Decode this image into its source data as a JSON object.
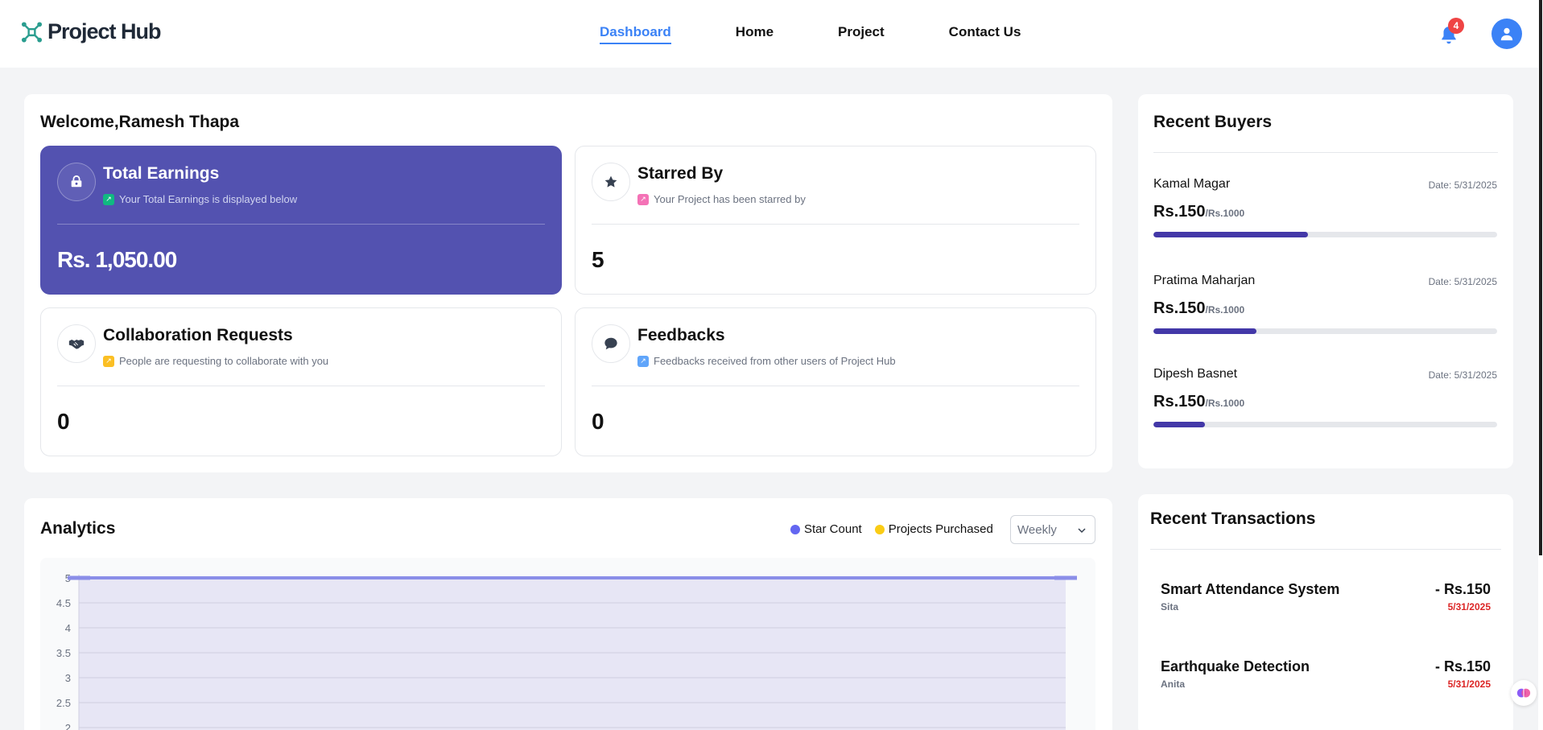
{
  "app": {
    "name": "Project Hub",
    "notification_count": "4"
  },
  "nav": {
    "items": [
      "Dashboard",
      "Home",
      "Project",
      "Contact Us"
    ],
    "active": "Dashboard"
  },
  "welcome": {
    "title": "Welcome,Ramesh Thapa"
  },
  "cards": [
    {
      "title": "Total Earnings",
      "subtitle": "Your Total Earnings is displayed below",
      "value": "Rs. 1,050.00",
      "icon": "earnings-icon",
      "badge_color": "#10b981"
    },
    {
      "title": "Starred By",
      "subtitle": "Your Project has been starred by",
      "value": "5",
      "icon": "star-icon",
      "badge_color": "#f472b6"
    },
    {
      "title": "Collaboration Requests",
      "subtitle": "People are requesting to collaborate with you",
      "value": "0",
      "icon": "handshake-icon",
      "badge_color": "#fbbf24"
    },
    {
      "title": "Feedbacks",
      "subtitle": "Feedbacks received from other users of Project Hub",
      "value": "0",
      "icon": "chat-icon",
      "badge_color": "#60a5fa"
    }
  ],
  "analytics": {
    "title": "Analytics",
    "legend": [
      {
        "label": "Star Count",
        "color": "#6366f1"
      },
      {
        "label": "Projects Purchased",
        "color": "#facc15"
      }
    ],
    "period": "Weekly"
  },
  "chart_data": {
    "type": "area",
    "series": [
      {
        "name": "Star Count",
        "values": [
          5,
          5
        ]
      }
    ],
    "yticks": [
      "5",
      "4.5",
      "4",
      "3.5",
      "3",
      "2.5",
      "2"
    ],
    "ylim": [
      2,
      5
    ]
  },
  "buyers": {
    "title": "Recent Buyers",
    "items": [
      {
        "name": "Kamal Magar",
        "date": "Date: 5/31/2025",
        "amount": "Rs.150",
        "total": "/Rs.1000",
        "progress": 0.45
      },
      {
        "name": "Pratima Maharjan",
        "date": "Date: 5/31/2025",
        "amount": "Rs.150",
        "total": "/Rs.1000",
        "progress": 0.3
      },
      {
        "name": "Dipesh Basnet",
        "date": "Date: 5/31/2025",
        "amount": "Rs.150",
        "total": "/Rs.1000",
        "progress": 0.15
      }
    ]
  },
  "transactions": {
    "title": "Recent Transactions",
    "items": [
      {
        "name": "Smart Attendance System",
        "user": "Sita",
        "amount": "- Rs.150",
        "date": "5/31/2025"
      },
      {
        "name": "Earthquake Detection",
        "user": "Anita",
        "amount": "- Rs.150",
        "date": "5/31/2025"
      }
    ]
  }
}
